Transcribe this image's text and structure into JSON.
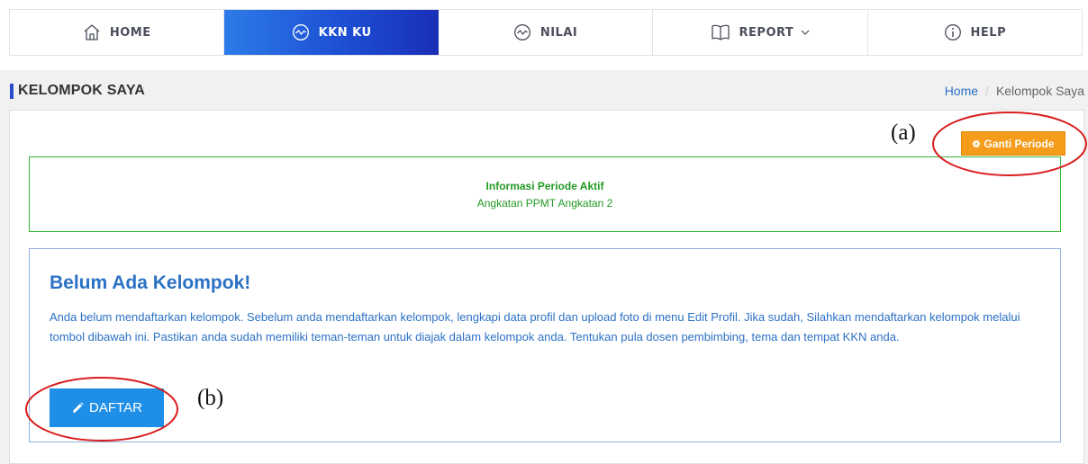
{
  "nav": {
    "items": [
      {
        "label": "HOME",
        "icon": "home-icon"
      },
      {
        "label": "KKN KU",
        "icon": "activity-icon",
        "active": true
      },
      {
        "label": "NILAI",
        "icon": "activity-icon"
      },
      {
        "label": "REPORT",
        "icon": "book-icon",
        "dropdown": true
      },
      {
        "label": "HELP",
        "icon": "info-icon"
      }
    ]
  },
  "page": {
    "title": "KELOMPOK SAYA",
    "breadcrumb": {
      "home": "Home",
      "sep": "/",
      "current": "Kelompok Saya"
    }
  },
  "toolbar": {
    "ganti_periode": "Ganti Periode"
  },
  "info": {
    "title": "Informasi Periode Aktif",
    "text": "Angkatan PPMT Angkatan 2"
  },
  "alert": {
    "heading": "Belum Ada Kelompok!",
    "text": "Anda belum mendaftarkan kelompok. Sebelum anda mendaftarkan kelompok, lengkapi data profil dan upload foto di menu Edit Profil. Jika sudah, Silahkan mendaftarkan kelompok melalui tombol dibawah ini. Pastikan anda sudah memiliki teman-teman untuk diajak dalam kelompok anda. Tentukan pula dosen pembimbing, tema dan tempat KKN anda.",
    "button": "DAFTAR"
  },
  "annotations": {
    "a": "(a)",
    "b": "(b)"
  },
  "colors": {
    "accent_blue": "#1f8ee6",
    "nav_active": "#1d4fd4",
    "warning": "#f59c1a",
    "success": "#229a22",
    "annotation": "#d91c1c"
  }
}
